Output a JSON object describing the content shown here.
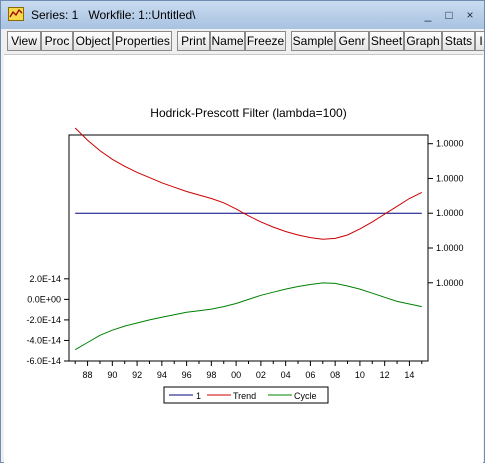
{
  "window": {
    "title": "Series: 1   Workfile: 1::Untitled\\",
    "controls": [
      "_",
      "□",
      "×"
    ]
  },
  "toolbar": {
    "buttons": [
      "View",
      "Proc",
      "Object",
      "Properties",
      "Print",
      "Name",
      "Freeze",
      "Sample",
      "Genr",
      "Sheet",
      "Graph",
      "Stats",
      "I"
    ]
  },
  "colors": {
    "series_1": "#000080",
    "trend": "#cc0000",
    "cycle": "#008000"
  },
  "chart_data": {
    "type": "line",
    "title": "Hodrick-Prescott Filter (lambda=100)",
    "x": [
      1987,
      1988,
      1989,
      1990,
      1991,
      1992,
      1993,
      1994,
      1995,
      1996,
      1997,
      1998,
      1999,
      2000,
      2001,
      2002,
      2003,
      2004,
      2005,
      2006,
      2007,
      2008,
      2009,
      2010,
      2011,
      2012,
      2013,
      2014,
      2015
    ],
    "x_tick_labels": [
      "88",
      "90",
      "92",
      "94",
      "96",
      "98",
      "00",
      "02",
      "04",
      "06",
      "08",
      "10",
      "12",
      "14"
    ],
    "xlim": [
      1986.5,
      2015.5
    ],
    "left_axis": {
      "ticks": [
        "2.0E-14",
        "0.0E+00",
        "-2.0E-14",
        "-4.0E-14",
        "-6.0E-14"
      ],
      "tick_values": [
        2e-14,
        0.0,
        -2e-14,
        -4e-14,
        -6e-14
      ],
      "ylim": [
        -6e-14,
        1.6e-13
      ]
    },
    "right_axis": {
      "ticks": [
        "1.0000",
        "1.0000",
        "1.0000",
        "1.0000",
        "1.0000"
      ],
      "tick_values": [
        4,
        2,
        0,
        -2,
        -4
      ],
      "ylim": [
        -8.5,
        4.5
      ],
      "note": "right-axis values are relative offsets (×1e-14) around 1.0000"
    },
    "series": [
      {
        "name": "1",
        "axis": "right",
        "values": [
          0,
          0,
          0,
          0,
          0,
          0,
          0,
          0,
          0,
          0,
          0,
          0,
          0,
          0,
          0,
          0,
          0,
          0,
          0,
          0,
          0,
          0,
          0,
          0,
          0,
          0,
          0,
          0,
          0
        ]
      },
      {
        "name": "Trend",
        "axis": "right",
        "values": [
          4.9,
          4.2,
          3.6,
          3.1,
          2.7,
          2.35,
          2.05,
          1.75,
          1.5,
          1.25,
          1.05,
          0.85,
          0.6,
          0.25,
          -0.15,
          -0.5,
          -0.8,
          -1.05,
          -1.25,
          -1.4,
          -1.5,
          -1.45,
          -1.25,
          -0.9,
          -0.5,
          -0.05,
          0.4,
          0.85,
          1.2
        ]
      },
      {
        "name": "Cycle",
        "axis": "left",
        "values": [
          -4.9e-14,
          -4.2e-14,
          -3.5e-14,
          -3e-14,
          -2.6e-14,
          -2.3e-14,
          -2e-14,
          -1.75e-14,
          -1.5e-14,
          -1.25e-14,
          -1.1e-14,
          -9.5e-15,
          -7e-15,
          -4e-15,
          0.0,
          4e-15,
          7e-15,
          1e-14,
          1.25e-14,
          1.45e-14,
          1.6e-14,
          1.55e-14,
          1.3e-14,
          1e-14,
          6e-15,
          2e-15,
          -2e-15,
          -4.5e-15,
          -7e-15
        ]
      }
    ],
    "legend": {
      "placement": "bottom-center",
      "entries": [
        "1",
        "Trend",
        "Cycle"
      ]
    },
    "grid": false
  }
}
